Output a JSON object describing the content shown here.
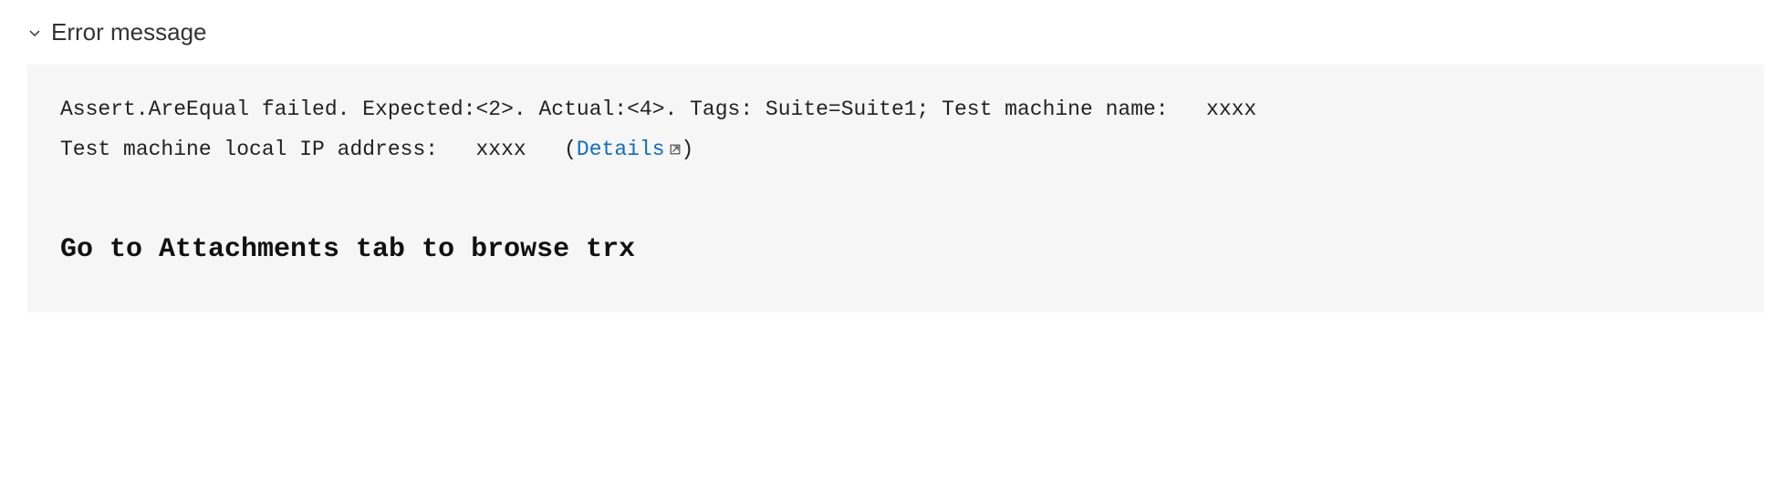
{
  "section": {
    "title": "Error message"
  },
  "error": {
    "line1_prefix": "Assert.AreEqual failed. Expected:<2>. Actual:<4>. Tags: Suite=Suite1; Test machine name:   ",
    "machine_name": "xxxx",
    "line2_prefix": "Test machine local IP address:   ",
    "ip": "xxxx",
    "paren_open": "   (",
    "details_label": "Details",
    "paren_close": ")",
    "instruction": "Go to Attachments tab to browse trx"
  }
}
